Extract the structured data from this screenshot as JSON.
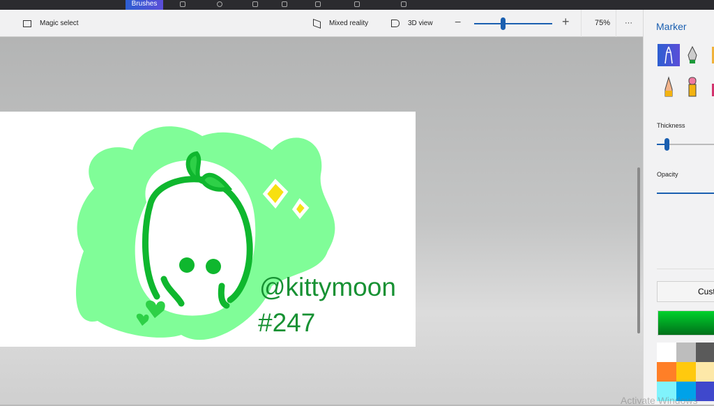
{
  "topbar": {
    "active_tab": "Brushes"
  },
  "toolbar": {
    "magic_select": "Magic select",
    "mixed_reality": "Mixed reality",
    "view_3d": "3D view",
    "zoom_level": "75%",
    "zoom_fraction": 0.37,
    "more": "···"
  },
  "artwork": {
    "handle": "@kittymoon",
    "number": "#247"
  },
  "panel": {
    "title": "Marker",
    "thickness_label": "Thickness",
    "thickness_value": 0.18,
    "opacity_label": "Opacity",
    "custom_label": "Custom",
    "current_color": "#00b52a",
    "palette": [
      "#ffffff",
      "#bdbdbd",
      "#5a5a5a",
      "#ff7f27",
      "#ffc90e",
      "#fde8a8",
      "#80f3fc",
      "#00a2e8",
      "#3f48cc"
    ]
  },
  "watermark": "Activate Windows"
}
